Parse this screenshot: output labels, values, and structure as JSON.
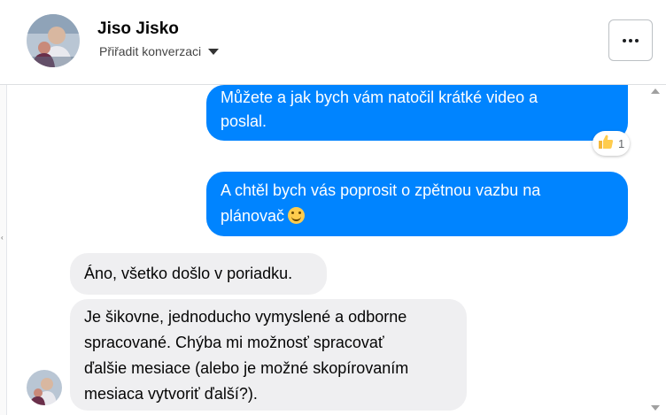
{
  "header": {
    "contact_name": "Jiso Jisko",
    "assign_label": "Přiřadit konverzaci"
  },
  "messages": [
    {
      "direction": "outgoing",
      "lines": [
        "Můžete a jak bych vám natočil krátké video a",
        "poslal."
      ],
      "reaction": {
        "emoji": "thumbs-up",
        "count": "1"
      }
    },
    {
      "direction": "outgoing",
      "lines": [
        "A chtěl bych vás poprosit o zpětnou vazbu na",
        "plánovač"
      ],
      "emoji": "smiling-face"
    },
    {
      "direction": "incoming",
      "lines": [
        "Áno, všetko došlo v poriadku."
      ]
    },
    {
      "direction": "incoming",
      "lines": [
        "Je šikovne, jednoducho vymyslené a odborne",
        "spracované. Chýba mi možnosť spracovať",
        "ďalšie mesiace (alebo je možné skopírovaním",
        "mesiaca vytvoriť ďalší?)."
      ]
    }
  ],
  "colors": {
    "outgoing_bubble": "#0084ff",
    "incoming_bubble": "#efeff1"
  },
  "icons": [
    "avatar",
    "chevron-down-icon",
    "more-icon",
    "thumbs-up-icon",
    "smiling-face-icon"
  ]
}
